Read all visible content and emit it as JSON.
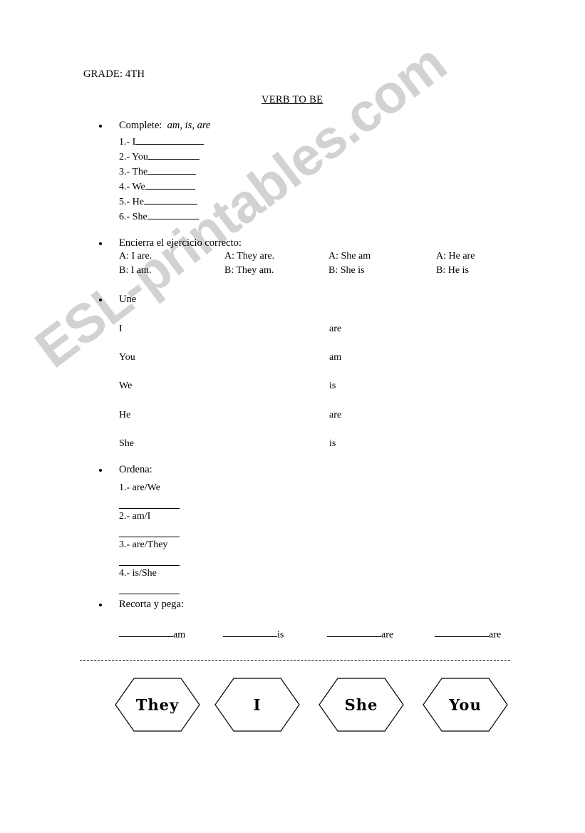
{
  "header": {
    "grade": "GRADE: 4TH",
    "title": "VERB TO BE"
  },
  "watermark": {
    "text": "ESL-printables.com",
    "color": "#d2d2d2"
  },
  "exercise1": {
    "instruction": "Complete:",
    "instruction_hint": "am, is, are",
    "items": [
      {
        "label": "1.- I"
      },
      {
        "label": "2.- You"
      },
      {
        "label": "3.- The"
      },
      {
        "label": "4.- We"
      },
      {
        "label": "5.- He"
      },
      {
        "label": "6.- She"
      }
    ]
  },
  "exercise2": {
    "instruction": "Encierra el ejercicio correcto:",
    "columns": [
      {
        "option_a": "A: I are.",
        "option_b": "B: I am."
      },
      {
        "option_a": "A: They are.",
        "option_b": "B: They am."
      },
      {
        "option_a": "A: She am",
        "option_b": "B: She is"
      },
      {
        "option_a": "A: He are",
        "option_b": "B: He is"
      }
    ]
  },
  "exercise3": {
    "instruction": "Une",
    "left": [
      "I",
      "You",
      "We",
      "He",
      "She"
    ],
    "right": [
      "are",
      "am",
      "is",
      "are",
      "is"
    ]
  },
  "exercise4": {
    "instruction": "Ordena:",
    "items": [
      "1.- are/We",
      "2.- am/I",
      "3.- are/They",
      "4.- is/She"
    ]
  },
  "exercise5": {
    "instruction": "Recorta y pega:",
    "slots": [
      "am",
      "is",
      "are",
      "are"
    ],
    "cards": [
      "They",
      "I",
      "She",
      "You"
    ]
  }
}
